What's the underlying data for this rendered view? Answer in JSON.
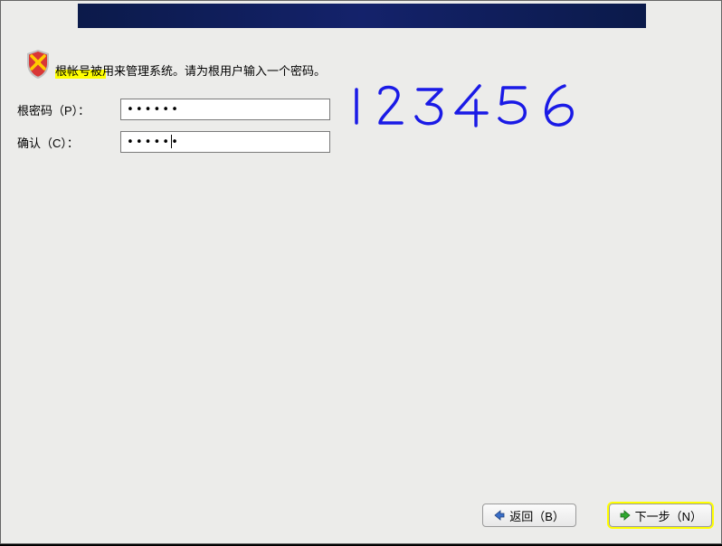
{
  "intro_text": "根帐号被用来管理系统。请为根用户输入一个密码。",
  "fields": {
    "password": {
      "label": "根密码（P）：",
      "value": "••••••"
    },
    "confirm": {
      "label": "确认（C）：",
      "value": "••••••"
    }
  },
  "handwriting": {
    "text": "123456",
    "color": "#1a1ae6"
  },
  "buttons": {
    "back": "返回（B）",
    "next": "下一步（N）"
  },
  "highlight_color": "#ffff00"
}
